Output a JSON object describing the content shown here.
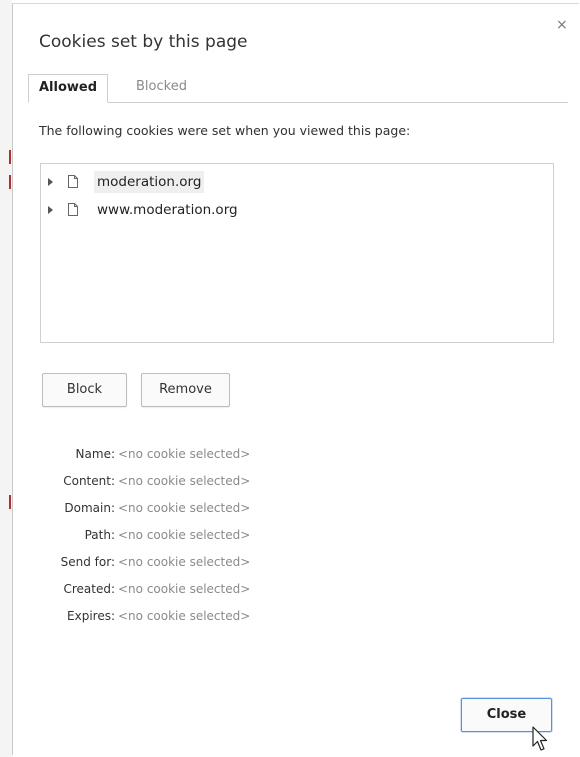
{
  "dialog": {
    "title": "Cookies set by this page",
    "close_glyph": "×"
  },
  "tabs": [
    {
      "label": "Allowed",
      "active": true
    },
    {
      "label": "Blocked",
      "active": false
    }
  ],
  "intro_text": "The following cookies were set when you viewed this page:",
  "tree": {
    "items": [
      {
        "label": "moderation.org",
        "icon": "document-icon",
        "selected": true
      },
      {
        "label": "www.moderation.org",
        "icon": "document-icon",
        "selected": false
      }
    ]
  },
  "actions": {
    "block_label": "Block",
    "remove_label": "Remove"
  },
  "details": [
    {
      "key": "Name:",
      "value": "<no cookie selected>"
    },
    {
      "key": "Content:",
      "value": "<no cookie selected>"
    },
    {
      "key": "Domain:",
      "value": "<no cookie selected>"
    },
    {
      "key": "Path:",
      "value": "<no cookie selected>"
    },
    {
      "key": "Send for:",
      "value": "<no cookie selected>"
    },
    {
      "key": "Created:",
      "value": "<no cookie selected>"
    },
    {
      "key": "Expires:",
      "value": "<no cookie selected>"
    }
  ],
  "footer": {
    "close_label": "Close"
  }
}
